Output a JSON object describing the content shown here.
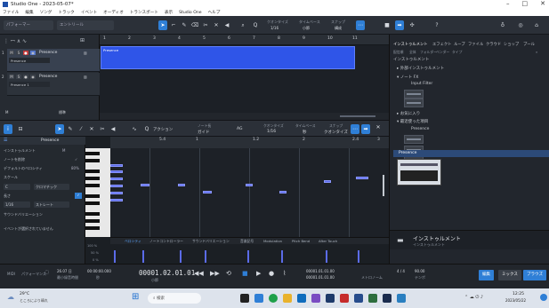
{
  "title_bar": {
    "title": "Studio One - 2023-05-07*",
    "min": "–",
    "max": "□",
    "close": "✕"
  },
  "menu": [
    "ファイル",
    "編集",
    "ソング",
    "トラック",
    "イベント",
    "オーディオ",
    "トランスポート",
    "表示",
    "Studio One",
    "ヘルプ"
  ],
  "toolbar": {
    "field1": "パフォーマー",
    "field2": "エントリール",
    "quantize_label": "クオンタイズ",
    "quantize_value": "1/16",
    "timebase_label": "タイムベース",
    "timebase_value": "小節",
    "snap_label": "スナップ",
    "snap_value": "構成"
  },
  "arrange": {
    "ruler": [
      "1",
      "2",
      "3",
      "4",
      "5",
      "6",
      "7",
      "8",
      "9",
      "10",
      "11"
    ],
    "tracks": [
      {
        "num": "1",
        "m": "M",
        "s": "S",
        "name": "Presence",
        "preset": "Presence"
      },
      {
        "num": "2",
        "m": "M",
        "s": "S",
        "name": "Presence",
        "preset": "Presence 1"
      }
    ],
    "clip_label": "Presence",
    "footer_left": "M",
    "footer_mid": "標準"
  },
  "browser": {
    "tabs": [
      "インストゥルメント",
      "エフェクト",
      "ループ",
      "ファイル",
      "クラウド",
      "ショップ",
      "プール"
    ],
    "subtabs": [
      "配信順",
      "全体",
      "フォルダー",
      "ベンダー",
      "タイプ"
    ],
    "header": "インストゥルメント",
    "tree": [
      "▸ 外部インストゥルメント",
      "▾ ノート FX",
      "Input Filter",
      "▸ お気に入り",
      "▾ 最近使った項目",
      "Presence"
    ],
    "preview_label": "Presence",
    "footer_title": "インストゥルメント",
    "footer_sub": "インストゥルメント"
  },
  "editor_toolbar": {
    "action": "アクション",
    "note_label": "ノート長",
    "note_value": "ガイド",
    "ag": "AG",
    "quantize_label": "クオンタイズ",
    "quantize_value": "1/16",
    "timebase_label": "タイムベース",
    "timebase_value": "秒",
    "snap_label": "スナップ",
    "snap_value": "クオンタイズ"
  },
  "inspector": {
    "track_name": "Presence",
    "rows": [
      {
        "label": "インストゥルメント",
        "value": "M"
      },
      {
        "label": "ノートを削除",
        "value": ""
      },
      {
        "label": "デフォルトのベロシティ",
        "value": "80%"
      },
      {
        "label": "スケール",
        "value": ""
      }
    ],
    "scale_key": "C",
    "scale_type": "クロマチック",
    "length_label": "長さ",
    "length_value": "1/16",
    "steps_label": "ストレート",
    "variation_label": "サウンドバリエーション",
    "empty_msg": "イベントが選択されていません"
  },
  "editor": {
    "ruler": [
      "5.4",
      "1",
      "1.2",
      "2",
      "2.4",
      "3"
    ],
    "lanes": [
      "ベロシティ",
      "ノートコントローラー",
      "サウンドバリエーション",
      "音楽記号",
      "Modulation",
      "Pitch Bend",
      "After Touch"
    ],
    "vel_top": "100 %",
    "vel_mid": "50 %",
    "vel_bot": "0 %"
  },
  "transport": {
    "midi_label": "MIDI",
    "perf_label": "パフォーマンス",
    "sample_rate": "48 kHz",
    "latency": "26.07 日",
    "latency_sub": "最小録音時間",
    "time_small": "00:00:00.000",
    "time_small_sub": "秒",
    "position": "00001.02.01.01",
    "position_sub": "小節",
    "loop_start": "00001.01.01.00",
    "loop_end": "00001.01.01.00",
    "metronome": "メトロノーム",
    "signature": "4 / 4",
    "tempo": "90.00",
    "tempo_label": "テンポ",
    "btn1": "編集",
    "btn2": "ミックス",
    "btn3": "ブラウズ"
  },
  "taskbar": {
    "weather_temp": "29°C",
    "weather_desc": "ところにより晴れ",
    "search_placeholder": "検索",
    "time": "12:25",
    "date": "2023/05/22"
  }
}
